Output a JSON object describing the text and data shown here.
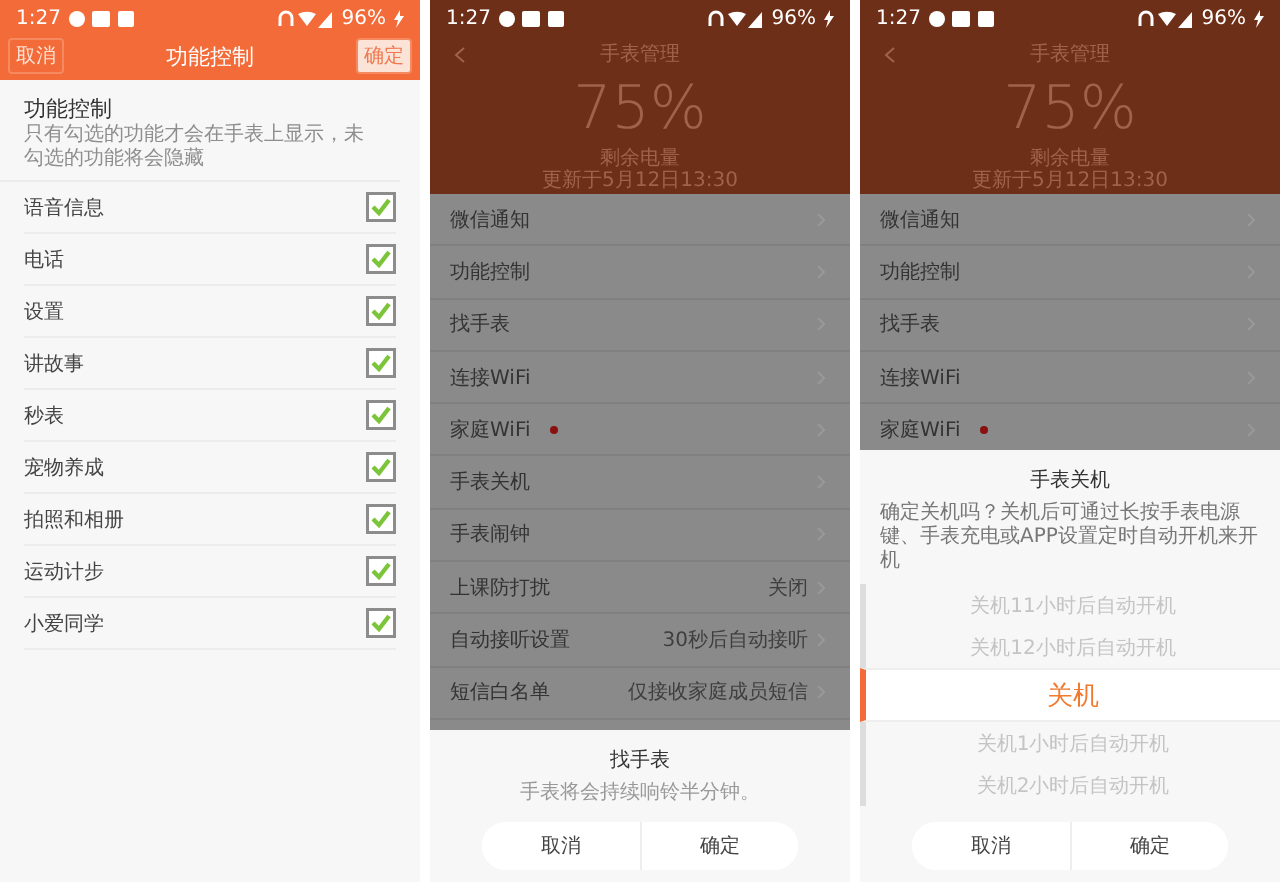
{
  "screens": [
    {
      "kind": "checklist",
      "status": {
        "time": "1:27",
        "battery": "96%"
      },
      "nav": {
        "cancel": "取消",
        "title": "功能控制",
        "confirm": "确定"
      },
      "heading": "功能控制",
      "subtitle": "只有勾选的功能才会在手表上显示，未勾选的功能将会隐藏",
      "items": [
        {
          "label": "语音信息",
          "checked": true
        },
        {
          "label": "电话",
          "checked": true
        },
        {
          "label": "设置",
          "checked": true
        },
        {
          "label": "讲故事",
          "checked": true
        },
        {
          "label": "秒表",
          "checked": true
        },
        {
          "label": "宠物养成",
          "checked": true
        },
        {
          "label": "拍照和相册",
          "checked": true
        },
        {
          "label": "运动计步",
          "checked": true
        },
        {
          "label": "小爱同学",
          "checked": true
        }
      ]
    },
    {
      "kind": "menu",
      "status": {
        "time": "1:27",
        "battery": "96%"
      },
      "title": "手表管理",
      "percent": "75%",
      "battery_label": "剩余电量",
      "updated": "更新于5月12日13:30",
      "items": [
        {
          "label": "微信通知"
        },
        {
          "label": "功能控制"
        },
        {
          "label": "找手表"
        },
        {
          "label": "连接WiFi"
        },
        {
          "label": "家庭WiFi",
          "badge": true
        },
        {
          "label": "手表关机"
        },
        {
          "label": "手表闹钟"
        },
        {
          "label": "上课防打扰",
          "value": "关闭"
        },
        {
          "label": "自动接听设置",
          "value": "30秒后自动接听"
        },
        {
          "label": "短信白名单",
          "value": "仅接收家庭成员短信"
        }
      ],
      "sheet": {
        "title": "找手表",
        "message": "手表将会持续响铃半分钟。",
        "cancel": "取消",
        "confirm": "确定"
      }
    },
    {
      "kind": "menu",
      "status": {
        "time": "1:27",
        "battery": "96%"
      },
      "title": "手表管理",
      "percent": "75%",
      "battery_label": "剩余电量",
      "updated": "更新于5月12日13:30",
      "items": [
        {
          "label": "微信通知"
        },
        {
          "label": "功能控制"
        },
        {
          "label": "找手表"
        },
        {
          "label": "连接WiFi"
        },
        {
          "label": "家庭WiFi",
          "badge": true
        }
      ],
      "sheet": {
        "title": "手表关机",
        "message": "确定关机吗？关机后可通过长按手表电源键、手表充电或APP设置定时自动开机来开机",
        "picker": [
          {
            "label": "关机11小时后自动开机",
            "selected": false
          },
          {
            "label": "关机12小时后自动开机",
            "selected": false
          },
          {
            "label": "关机",
            "selected": true
          },
          {
            "label": "关机1小时后自动开机",
            "selected": false
          },
          {
            "label": "关机2小时后自动开机",
            "selected": false
          }
        ],
        "cancel": "取消",
        "confirm": "确定"
      }
    }
  ]
}
